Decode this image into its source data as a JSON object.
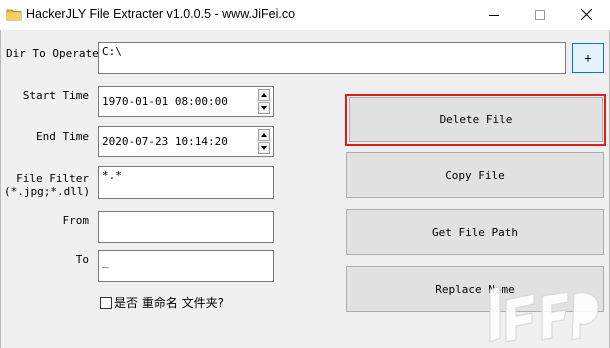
{
  "window": {
    "title": "HackerJLY File Extracter v1.0.0.5 - www.JiFei.co",
    "minimize_icon": "minimize-icon",
    "maximize_icon": "maximize-icon",
    "close_icon": "close-icon"
  },
  "form": {
    "dir_label": "Dir To Operate",
    "dir_value": "C:\\",
    "browse_label": "+",
    "start_label": "Start Time",
    "start_value": "1970-01-01 08:00:00",
    "end_label": "End Time",
    "end_value": "2020-07-23 10:14:20",
    "filter_label_1": "File Filter",
    "filter_label_2": "(*.jpg;*.dll)",
    "filter_value": "*.*",
    "from_label": "From",
    "from_value": "",
    "to_label": "To",
    "to_value": "_",
    "rename_folder_label": "是否 重命名 文件夹?",
    "rename_folder_checked": false
  },
  "actions": {
    "delete_label": "Delete File",
    "copy_label": "Copy File",
    "getpath_label": "Get File Path",
    "replace_label": "Replace Name"
  },
  "colors": {
    "highlight": "#e01c1c",
    "focus_border": "#0078d7"
  }
}
